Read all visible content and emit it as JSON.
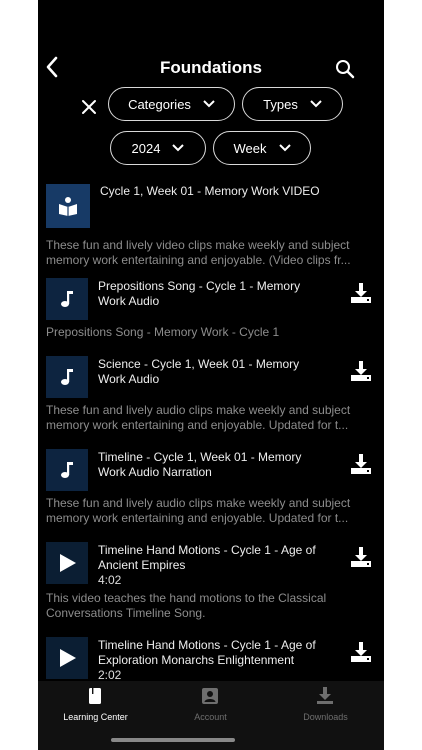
{
  "header": {
    "title": "Foundations"
  },
  "filters": {
    "row1": [
      "Categories",
      "Types"
    ],
    "row2": [
      "2024",
      "Week"
    ]
  },
  "items": [
    {
      "title_lines": [
        "Cycle 1, Week 01 - Memory Work VIDEO"
      ],
      "icon": "book-icon",
      "desc": [
        "These fun and lively video clips make weekly and subject",
        "memory work entertaining and enjoyable. (Video clips fr..."
      ]
    },
    {
      "title_lines": [
        "Prepositions Song - Cycle 1 - Memory",
        "Work Audio"
      ],
      "icon": "music-note-icon",
      "desc": [
        "Prepositions Song - Memory Work - Cycle 1"
      ]
    },
    {
      "title_lines": [
        "Science - Cycle 1, Week 01 - Memory",
        "Work Audio"
      ],
      "icon": "music-note-icon",
      "desc": [
        "These fun and lively audio clips make weekly and subject",
        "memory work entertaining and enjoyable. Updated for t..."
      ]
    },
    {
      "title_lines": [
        "Timeline - Cycle 1, Week 01 - Memory",
        "Work Audio Narration"
      ],
      "icon": "music-note-icon",
      "desc": [
        "These fun and lively audio clips make weekly and subject",
        "memory work entertaining and enjoyable. Updated for t..."
      ]
    },
    {
      "title_lines": [
        "Timeline Hand Motions -  Cycle 1 - Age of",
        "Ancient Empires"
      ],
      "duration": "4:02",
      "icon": "play-icon",
      "desc": [
        "This video teaches the hand motions to the Classical",
        "Conversations Timeline Song."
      ]
    },
    {
      "title_lines": [
        "Timeline Hand Motions -  Cycle 1 - Age of",
        "Exploration Monarchs Enlightenment"
      ],
      "duration": "2:02",
      "icon": "play-icon",
      "desc": []
    }
  ],
  "tabs": [
    {
      "label": "Learning Center",
      "icon": "learning-center-icon",
      "active": true
    },
    {
      "label": "Account",
      "icon": "account-icon",
      "active": false
    },
    {
      "label": "Downloads",
      "icon": "downloads-icon",
      "active": false
    }
  ],
  "colors": {
    "background": "#000000",
    "thumb": "#0d2440",
    "muted_text": "#8d8d8d",
    "inactive_tab": "#6e6e6e"
  }
}
